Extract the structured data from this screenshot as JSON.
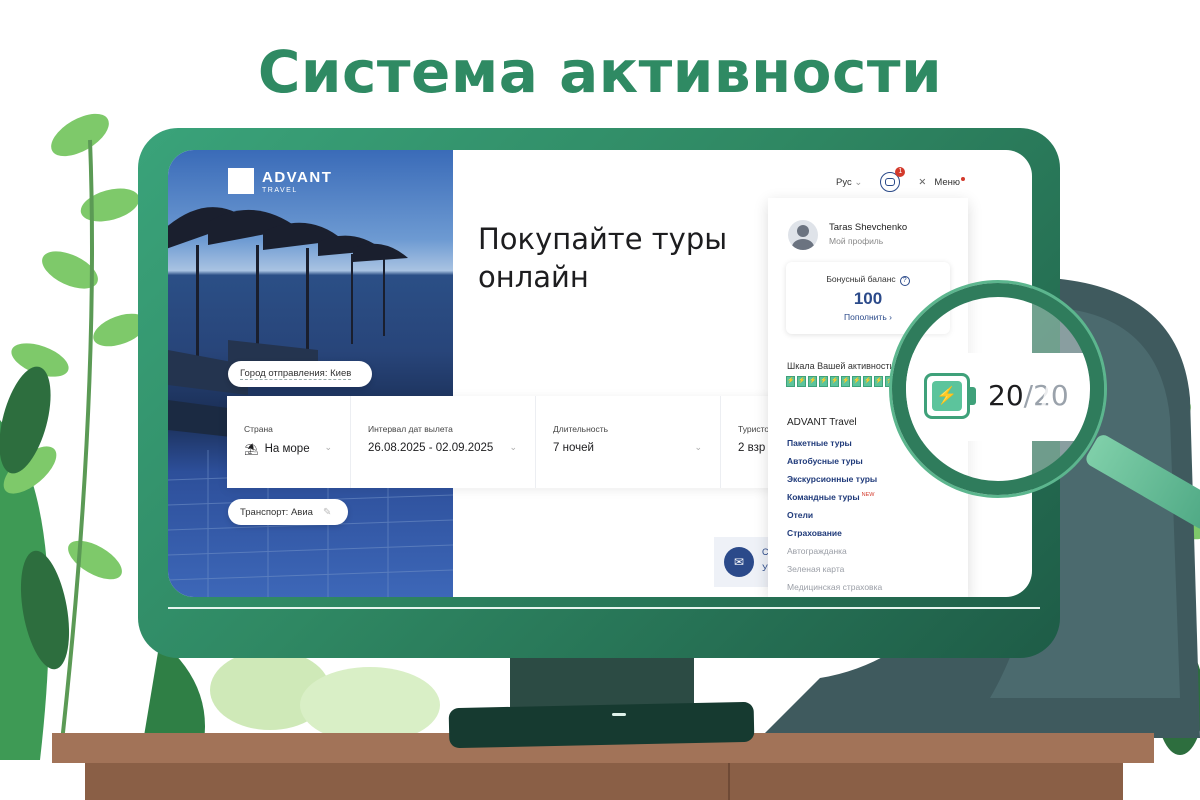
{
  "banner": {
    "headline": "Система активности"
  },
  "site": {
    "logo": {
      "name": "ADVANT",
      "sub": "TRAVEL"
    },
    "nav": {
      "language": "Рус",
      "notifications_count": "1",
      "menu_label": "Меню"
    },
    "hero": {
      "title": "Покупайте туры онлайн"
    },
    "departure_city": "Город отправления: Киев",
    "transport": "Транспорт: Авиа",
    "search": {
      "country_label": "Страна",
      "country_value": "На море",
      "dates_label": "Интервал дат вылета",
      "dates_value": "26.08.2025 - 02.09.2025",
      "duration_label": "Длительность",
      "duration_value": "7 ночей",
      "tourists_label": "Туристо",
      "tourists_value": "2 взр"
    },
    "contact_partial": {
      "line1": "С",
      "line2": "У"
    }
  },
  "profile_menu": {
    "user_name": "Taras Shevchenko",
    "profile_link": "Мой профиль",
    "bonus": {
      "label": "Бонусный баланс",
      "value": "100",
      "topup": "Пополнить ›"
    },
    "activity": {
      "label": "Шкала Вашей активности",
      "current": 20,
      "total": 20,
      "segment_icon": "lightning-icon"
    },
    "section_title": "ADVANT Travel",
    "items": [
      {
        "label": "Пакетные туры",
        "muted": false
      },
      {
        "label": "Автобусные туры",
        "muted": false
      },
      {
        "label": "Экскурсионные туры",
        "muted": false
      },
      {
        "label": "Командные туры",
        "muted": false,
        "badge": "NEW"
      },
      {
        "label": "Отели",
        "muted": false
      },
      {
        "label": "Страхование",
        "muted": false
      },
      {
        "label": "Автогражданка",
        "muted": true
      },
      {
        "label": "Зеленая карта",
        "muted": true
      },
      {
        "label": "Медицинская страховка",
        "muted": true
      }
    ]
  },
  "zoom": {
    "current": "20",
    "separator": "/",
    "total": "20"
  },
  "colors": {
    "brand_green": "#2f8a63",
    "link_blue": "#1f3a7a",
    "accent_red": "#d33a2c",
    "battery_green": "#5cc49c"
  }
}
